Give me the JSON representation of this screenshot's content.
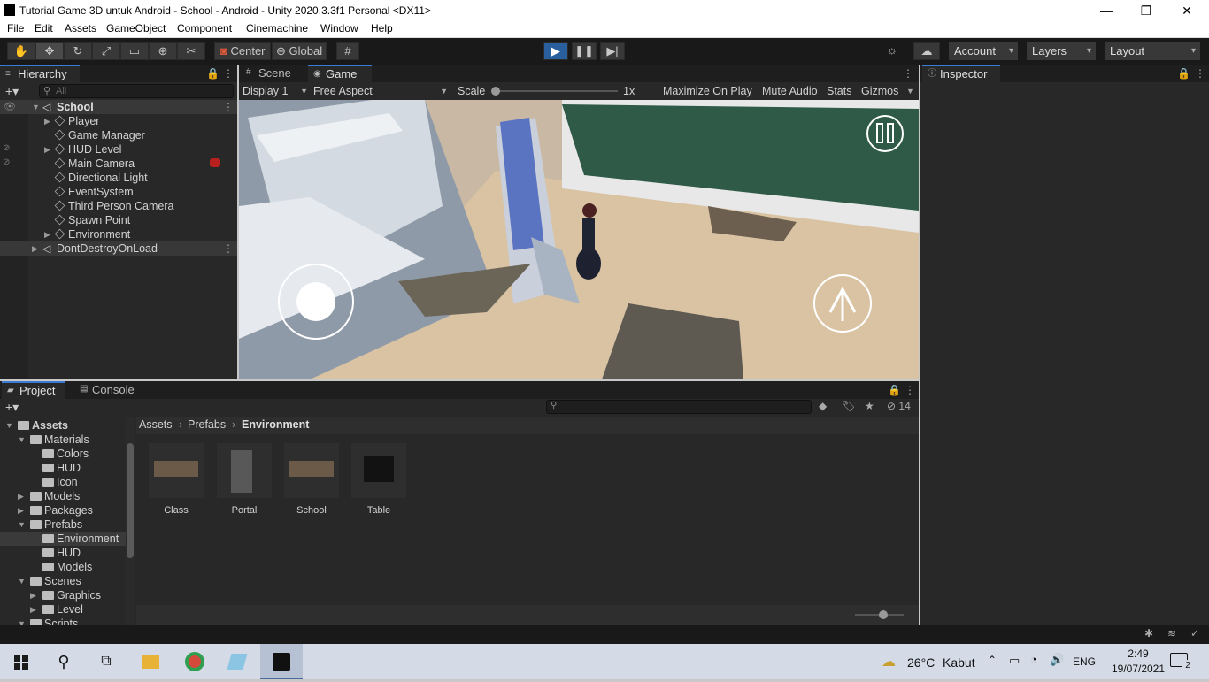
{
  "window": {
    "title": "Tutorial Game 3D untuk Android - School - Android - Unity 2020.3.3f1 Personal <DX11>",
    "minimize": "—",
    "maximize": "❐",
    "close": "✕"
  },
  "menu": [
    "File",
    "Edit",
    "Assets",
    "GameObject",
    "Component",
    "Cinemachine",
    "Window",
    "Help"
  ],
  "toolbar": {
    "pivot": "Center",
    "space": "Global",
    "account": "Account",
    "layers": "Layers",
    "layout": "Layout"
  },
  "hierarchy": {
    "tab": "Hierarchy",
    "search_placeholder": "All",
    "scene": "School",
    "items": [
      "Player",
      "Game Manager",
      "HUD Level",
      "Main Camera",
      "Directional Light",
      "EventSystem",
      "Third Person Camera",
      "Spawn Point",
      "Environment"
    ],
    "ddol": "DontDestroyOnLoad"
  },
  "game_view": {
    "tabs": [
      "Scene",
      "Game"
    ],
    "display": "Display 1",
    "aspect": "Free Aspect",
    "scale_label": "Scale",
    "scale_value": "1x",
    "maximize": "Maximize On Play",
    "mute": "Mute Audio",
    "stats": "Stats",
    "gizmos": "Gizmos"
  },
  "inspector": {
    "tab": "Inspector"
  },
  "project": {
    "tabs": [
      "Project",
      "Console"
    ],
    "hidden_count": "14",
    "breadcrumb": [
      "Assets",
      "Prefabs",
      "Environment"
    ],
    "tree": [
      {
        "label": "Assets",
        "indent": 0,
        "arrow": "open",
        "bold": true
      },
      {
        "label": "Materials",
        "indent": 1,
        "arrow": "open"
      },
      {
        "label": "Colors",
        "indent": 2,
        "arrow": ""
      },
      {
        "label": "HUD",
        "indent": 2,
        "arrow": ""
      },
      {
        "label": "Icon",
        "indent": 2,
        "arrow": ""
      },
      {
        "label": "Models",
        "indent": 1,
        "arrow": "closed"
      },
      {
        "label": "Packages",
        "indent": 1,
        "arrow": "closed"
      },
      {
        "label": "Prefabs",
        "indent": 1,
        "arrow": "open"
      },
      {
        "label": "Environment",
        "indent": 2,
        "arrow": "",
        "selected": true
      },
      {
        "label": "HUD",
        "indent": 2,
        "arrow": ""
      },
      {
        "label": "Models",
        "indent": 2,
        "arrow": ""
      },
      {
        "label": "Scenes",
        "indent": 1,
        "arrow": "open"
      },
      {
        "label": "Graphics",
        "indent": 2,
        "arrow": "closed"
      },
      {
        "label": "Level",
        "indent": 2,
        "arrow": "closed"
      },
      {
        "label": "Scripts",
        "indent": 1,
        "arrow": "open"
      }
    ],
    "assets": [
      "Class",
      "Portal",
      "School",
      "Table"
    ]
  },
  "taskbar": {
    "weather_temp": "26°C",
    "weather_desc": "Kabut",
    "lang": "ENG",
    "time": "2:49",
    "date": "19/07/2021",
    "notifications": "2"
  }
}
